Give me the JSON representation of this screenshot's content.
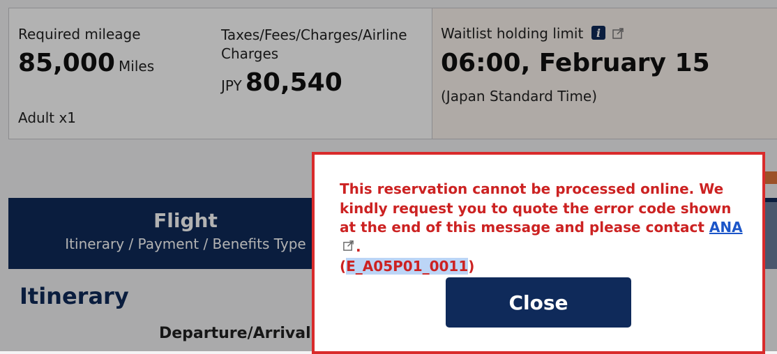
{
  "summary": {
    "required_mileage_label": "Required mileage",
    "mileage_value": "85,000",
    "mileage_unit": "Miles",
    "passengers": "Adult x1",
    "taxes_label_line1": "Taxes/Fees/Charges/Airline",
    "taxes_label_line2": "Charges",
    "currency": "JPY",
    "taxes_value": "80,540",
    "waitlist_label": "Waitlist holding limit",
    "waitlist_value": "06:00, February 15",
    "waitlist_timezone": "(Japan Standard Time)"
  },
  "tab": {
    "title": "Flight",
    "subtitle": "Itinerary / Payment / Benefits Type"
  },
  "itinerary": {
    "title": "Itinerary",
    "departure_arrival": "Departure/Arrival"
  },
  "dialog": {
    "message_before_link": "This reservation cannot be processed online. We kindly request you to quote the error code shown at the end of this message and please contact",
    "link_text": "ANA",
    "period": ".",
    "open_paren": "(",
    "error_code": "E_A05P01_0011",
    "close_paren": ")",
    "close_button": "Close"
  },
  "colors": {
    "navy": "#0f2a5a",
    "error_red": "#d92b2b",
    "link_blue": "#1b55c8",
    "accent_orange": "#e0743a"
  }
}
